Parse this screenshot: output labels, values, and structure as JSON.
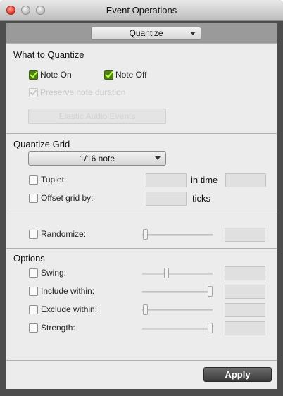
{
  "window": {
    "title": "Event Operations"
  },
  "operation_select": {
    "value": "Quantize"
  },
  "what_to_quantize": {
    "heading": "What to Quantize",
    "note_on": {
      "label": "Note On",
      "checked": true
    },
    "note_off": {
      "label": "Note Off",
      "checked": true
    },
    "preserve": {
      "label": "Preserve note duration",
      "checked": true,
      "enabled": false
    },
    "elastic_button": "Elastic Audio Events"
  },
  "quantize_grid": {
    "heading": "Quantize Grid",
    "grid_value": "1/16 note",
    "tuplet": {
      "label": "Tuplet:",
      "suffix": "in time"
    },
    "offset": {
      "label": "Offset grid by:",
      "suffix": "ticks"
    },
    "randomize": {
      "label": "Randomize:",
      "level": 0
    }
  },
  "options": {
    "heading": "Options",
    "swing": {
      "label": "Swing:",
      "level": 0.33
    },
    "include_within": {
      "label": "Include within:",
      "level": 1
    },
    "exclude_within": {
      "label": "Exclude within:",
      "level": 0
    },
    "strength": {
      "label": "Strength:",
      "level": 1
    }
  },
  "footer": {
    "apply_label": "Apply"
  }
}
